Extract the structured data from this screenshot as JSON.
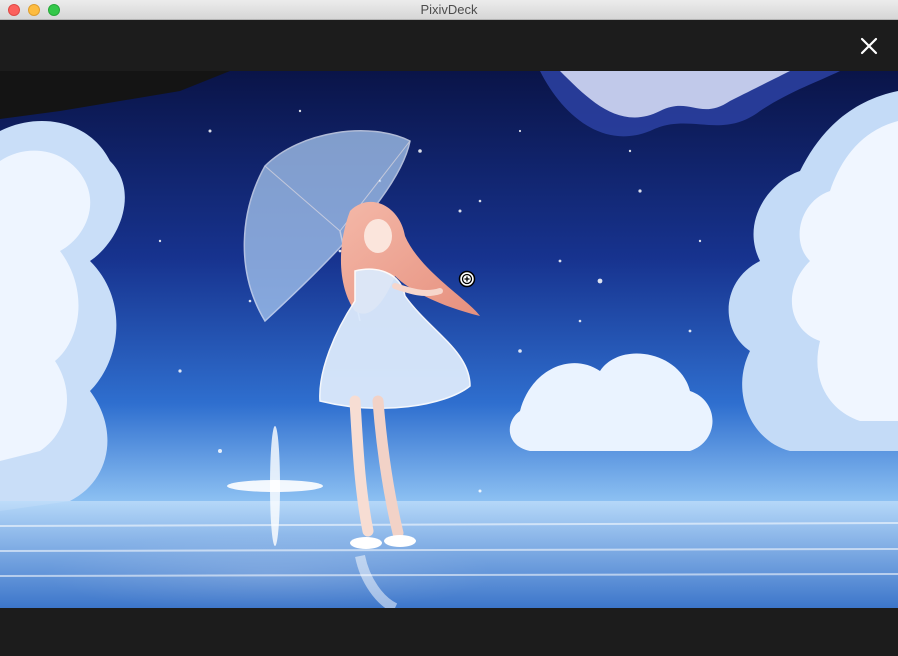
{
  "window": {
    "title": "PixivDeck"
  },
  "viewer": {
    "close_icon": "close-icon",
    "cursor_icon": "zoom-in-cursor-icon"
  },
  "colors": {
    "titlebar": "#e3e3e3",
    "viewer_background": "#1c1c1c",
    "sky_dark": "#0a1448",
    "sky_mid": "#1e4fb0",
    "sky_light": "#7fb4f0",
    "cloud": "#eaf3ff"
  }
}
